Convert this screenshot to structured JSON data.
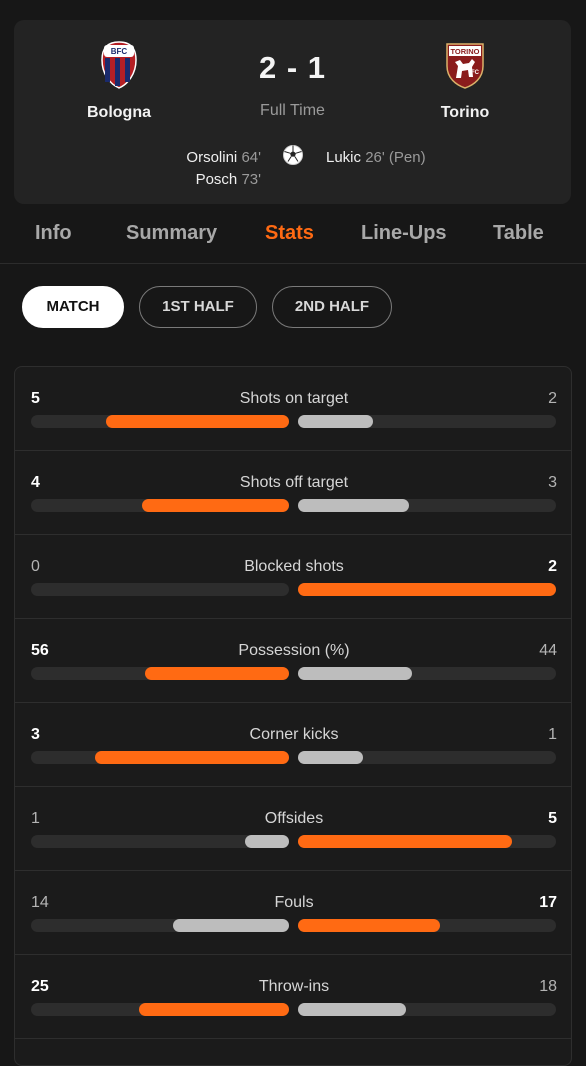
{
  "match": {
    "home": {
      "name": "Bologna",
      "crest_colors": [
        "#1a2a6c",
        "#b51f24"
      ]
    },
    "away": {
      "name": "Torino",
      "crest_colors": [
        "#8a1c1c",
        "#ffffff"
      ]
    },
    "score": "2 - 1",
    "status": "Full Time",
    "home_scorers": [
      {
        "name": "Orsolini",
        "minute": "64'"
      },
      {
        "name": "Posch",
        "minute": "73'"
      }
    ],
    "away_scorers": [
      {
        "name": "Lukic",
        "minute": "26' (Pen)"
      }
    ]
  },
  "tabs": [
    "Info",
    "Summary",
    "Stats",
    "Line-Ups",
    "Table"
  ],
  "active_tab": "Stats",
  "periods": [
    "MATCH",
    "1ST HALF",
    "2ND HALF"
  ],
  "active_period": "MATCH",
  "colors": {
    "accent": "#ff6a13",
    "secondary_bar": "#bdbdbd",
    "track": "#2d2d2d"
  },
  "stats": [
    {
      "label": "Shots on target",
      "home": "5",
      "away": "2",
      "home_share": 0.71,
      "away_share": 0.29
    },
    {
      "label": "Shots off target",
      "home": "4",
      "away": "3",
      "home_share": 0.57,
      "away_share": 0.43
    },
    {
      "label": "Blocked shots",
      "home": "0",
      "away": "2",
      "home_share": 0.0,
      "away_share": 1.0
    },
    {
      "label": "Possession (%)",
      "home": "56",
      "away": "44",
      "home_share": 0.56,
      "away_share": 0.44
    },
    {
      "label": "Corner kicks",
      "home": "3",
      "away": "1",
      "home_share": 0.75,
      "away_share": 0.25
    },
    {
      "label": "Offsides",
      "home": "1",
      "away": "5",
      "home_share": 0.17,
      "away_share": 0.83
    },
    {
      "label": "Fouls",
      "home": "14",
      "away": "17",
      "home_share": 0.45,
      "away_share": 0.55
    },
    {
      "label": "Throw-ins",
      "home": "25",
      "away": "18",
      "home_share": 0.58,
      "away_share": 0.42
    }
  ]
}
